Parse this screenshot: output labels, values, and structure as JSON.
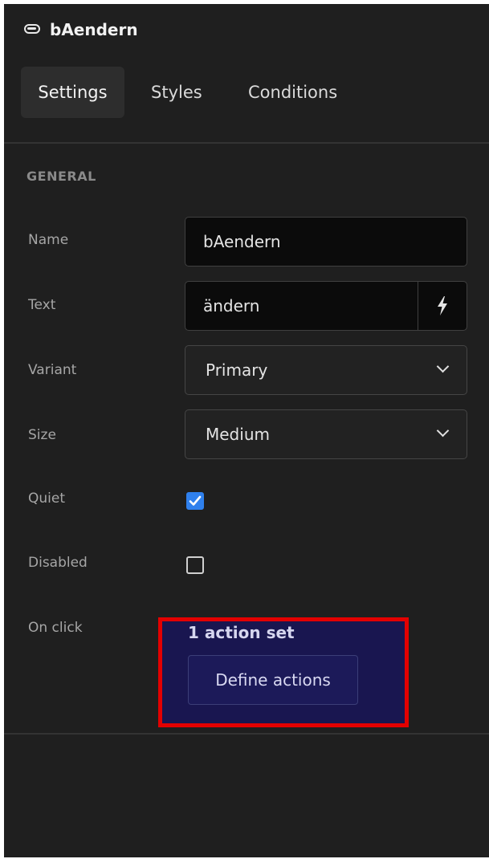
{
  "header": {
    "title": "bAendern",
    "icon": "button-toggle-icon"
  },
  "tabs": [
    {
      "label": "Settings",
      "active": true
    },
    {
      "label": "Styles",
      "active": false
    },
    {
      "label": "Conditions",
      "active": false
    }
  ],
  "section": {
    "title": "GENERAL"
  },
  "fields": {
    "name": {
      "label": "Name",
      "value": "bAendern"
    },
    "text": {
      "label": "Text",
      "value": "ändern",
      "bind_icon": "lightning-bolt-icon"
    },
    "variant": {
      "label": "Variant",
      "value": "Primary"
    },
    "size": {
      "label": "Size",
      "value": "Medium"
    },
    "quiet": {
      "label": "Quiet",
      "checked": true
    },
    "disabled": {
      "label": "Disabled",
      "checked": false
    },
    "on_click": {
      "label": "On click",
      "summary": "1 action set",
      "button_label": "Define actions"
    }
  },
  "colors": {
    "panel_bg": "#1f1f1f",
    "accent_blue": "#2f80ed",
    "highlight_border": "#e30000",
    "highlight_bg": "#191650"
  }
}
